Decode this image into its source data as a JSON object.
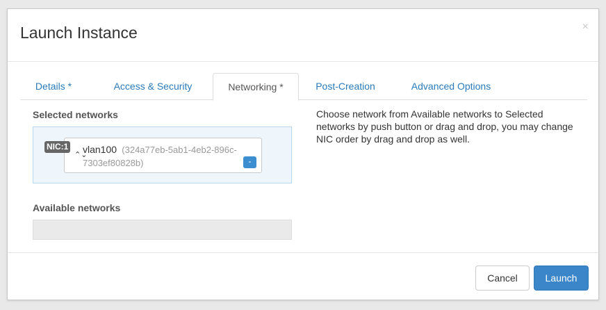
{
  "modal": {
    "title": "Launch Instance",
    "close_label": "×"
  },
  "tabs": [
    {
      "label": "Details *",
      "active": false
    },
    {
      "label": "Access & Security",
      "active": false
    },
    {
      "label": "Networking *",
      "active": true
    },
    {
      "label": "Post-Creation",
      "active": false
    },
    {
      "label": "Advanced Options",
      "active": false
    }
  ],
  "networking": {
    "selected_label": "Selected networks",
    "available_label": "Available networks",
    "selected_networks": [
      {
        "nic": "NIC:1",
        "name": "vlan100",
        "id": "(324a77eb-5ab1-4eb2-896c-7303ef80828b)",
        "remove_label": "-"
      }
    ],
    "help_text": "Choose network from Available networks to Selected networks by push button or drag and drop, you may change NIC order by drag and drop as well."
  },
  "footer": {
    "cancel_label": "Cancel",
    "launch_label": "Launch"
  },
  "colors": {
    "link": "#2a7ab8",
    "primary": "#3a86c8",
    "selected_bg": "#eef6fc"
  }
}
